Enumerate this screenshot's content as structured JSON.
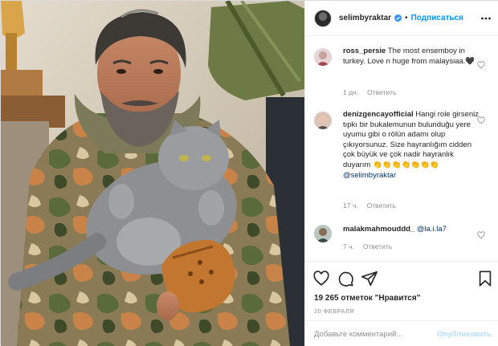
{
  "header": {
    "username": "selimbyraktar",
    "separator": "•",
    "follow_label": "Подписаться"
  },
  "comments": [
    {
      "username": "ross_persie",
      "text": "The most ensemboy in turkey. Love n huge from malaysiaa.🖤",
      "time": "1 дн.",
      "reply_label": "Ответить"
    },
    {
      "username": "denizgencayofficial",
      "text": "Hangi role girseniz tıpkı bir bukalemunun bulunduğu yere uyumu gibi o rölün adamı olup çıkıyorsunuz. Size hayranlığım cidden çok büyük ve çok nadir hayranlık duyarım 👏👏👏👏👏👏👏",
      "mention": "@selimbyraktar",
      "time": "17 ч.",
      "reply_label": "Ответить"
    },
    {
      "username": "malakmahmouddd_",
      "mention": "@la.i.la7",
      "time": "7 ч.",
      "reply_label": "Ответить"
    }
  ],
  "post": {
    "likes_text": "19 265 отметок \"Нравится\"",
    "date": "20 февраля"
  },
  "add_comment": {
    "placeholder": "Добавьте комментарий...",
    "publish_label": "Опубликовать"
  },
  "icons": {
    "verified": "verified-badge-icon",
    "more": "more-options-icon",
    "like": "heart-icon",
    "comment": "comment-icon",
    "share": "paper-plane-icon",
    "save": "bookmark-icon"
  },
  "colors": {
    "accent": "#0095f6",
    "publish_disabled": "#b2dffc",
    "secondary_text": "#8e8e8e",
    "mention": "#00376b"
  }
}
